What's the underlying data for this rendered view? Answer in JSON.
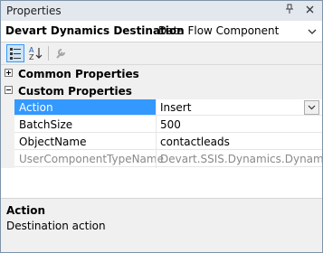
{
  "window": {
    "title": "Properties"
  },
  "titlebar_buttons": {
    "pin_icon": "pin-icon",
    "close_icon": "close-icon"
  },
  "object_selector": {
    "name": "Devart Dynamics Destination",
    "type": "Data Flow Component"
  },
  "toolbar": {
    "tools": [
      "categorized-icon",
      "alphabetical-icon",
      "property-pages-icon"
    ],
    "selected": "categorized-icon"
  },
  "grid": {
    "categories": [
      {
        "label": "Common Properties",
        "expanded": false
      },
      {
        "label": "Custom Properties",
        "expanded": true
      }
    ],
    "properties": [
      {
        "name": "Action",
        "value": "Insert",
        "selected": true,
        "readonly": false
      },
      {
        "name": "BatchSize",
        "value": "500",
        "selected": false,
        "readonly": false
      },
      {
        "name": "ObjectName",
        "value": "contactleads",
        "selected": false,
        "readonly": false
      },
      {
        "name": "UserComponentTypeName",
        "value": "Devart.SSIS.Dynamics.DynamicsDe",
        "selected": false,
        "readonly": true
      }
    ]
  },
  "description": {
    "title": "Action",
    "text": "Destination action"
  },
  "colors": {
    "selection": "#3399ff",
    "titlebar": "#e3e8ef",
    "panel": "#f0f0f0"
  }
}
